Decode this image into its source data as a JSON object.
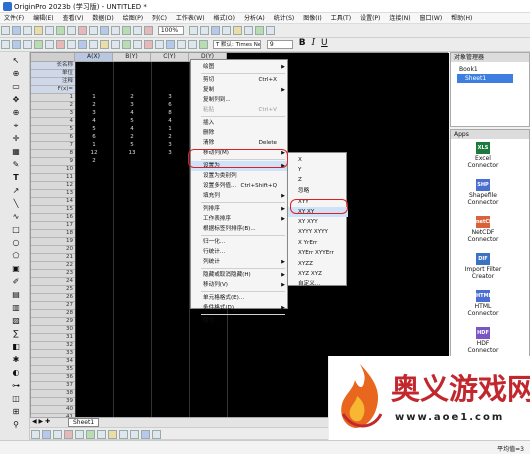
{
  "window": {
    "title": "OriginPro 2023b (学习版) - UNTITLED *"
  },
  "menubar": [
    "文件(F)",
    "编辑(E)",
    "查看(V)",
    "数据(D)",
    "绘图(P)",
    "列(C)",
    "工作表(W)",
    "格式(O)",
    "分析(A)",
    "统计(S)",
    "图像(I)",
    "工具(T)",
    "设置(P)",
    "连接(N)",
    "窗口(W)",
    "帮助(H)"
  ],
  "toolbar": {
    "zoom": "100%",
    "font_name": "T 默认: Times New",
    "font_size": "9",
    "bold": "B",
    "italic": "I",
    "underline": "U"
  },
  "worksheet": {
    "columns": [
      "A(X)",
      "B(Y)",
      "C(Y)",
      "D(Y)"
    ],
    "meta_rows": [
      "长名称",
      "单位",
      "注释",
      "F(x)="
    ],
    "row_numbers": [
      "1",
      "2",
      "3",
      "4",
      "5",
      "6",
      "7",
      "8",
      "9",
      "10",
      "11",
      "12",
      "13",
      "14",
      "15",
      "16",
      "17",
      "18",
      "19",
      "20",
      "21",
      "22",
      "23",
      "24",
      "25",
      "26",
      "27",
      "28",
      "29",
      "30",
      "31",
      "32",
      "33",
      "34",
      "35",
      "36",
      "37",
      "38",
      "39",
      "40",
      "41"
    ],
    "cells": [
      [
        "1",
        "2",
        "3"
      ],
      [
        "2",
        "3",
        "6"
      ],
      [
        "3",
        "4",
        "8"
      ],
      [
        "4",
        "5",
        "4"
      ],
      [
        "5",
        "4",
        "1"
      ],
      [
        "6",
        "2",
        "2"
      ],
      [
        "1",
        "5",
        "3"
      ],
      [
        "12",
        "13",
        "3"
      ],
      [
        "2",
        "",
        ""
      ]
    ]
  },
  "context_menu": {
    "items": [
      {
        "label": "绘图",
        "shortcut": "",
        "arrow": true
      },
      {
        "label": "剪切",
        "shortcut": "Ctrl+X"
      },
      {
        "label": "复制",
        "shortcut": "",
        "arrow": true
      },
      {
        "label": "复制列到...",
        "shortcut": ""
      },
      {
        "label": "粘贴",
        "shortcut": "Ctrl+V",
        "disabled": true
      },
      {
        "label": "插入",
        "shortcut": ""
      },
      {
        "label": "删除",
        "shortcut": ""
      },
      {
        "label": "清除",
        "shortcut": "Delete"
      },
      {
        "label": "移动列(M)",
        "shortcut": "",
        "arrow": true
      },
      {
        "label": "设置为",
        "shortcut": "",
        "arrow": true,
        "highlight": true
      },
      {
        "label": "设置为类别列",
        "shortcut": ""
      },
      {
        "label": "设置多列值...",
        "shortcut": "Ctrl+Shift+Q"
      },
      {
        "label": "填充列",
        "shortcut": "",
        "arrow": true
      },
      {
        "label": "列排序",
        "shortcut": "",
        "arrow": true
      },
      {
        "label": "工作表排序",
        "shortcut": "",
        "arrow": true
      },
      {
        "label": "根据标签列排序(B)...",
        "shortcut": ""
      },
      {
        "label": "归一化...",
        "shortcut": ""
      },
      {
        "label": "行统计...",
        "shortcut": ""
      },
      {
        "label": "列统计",
        "shortcut": "",
        "arrow": true
      },
      {
        "label": "隐藏或取消隐藏(H)",
        "shortcut": "",
        "arrow": true
      },
      {
        "label": "移动列(V)",
        "shortcut": "",
        "arrow": true
      },
      {
        "label": "单元格格式(E)...",
        "shortcut": ""
      },
      {
        "label": "条件格式(D)",
        "shortcut": "",
        "arrow": true
      },
      {
        "label": "属性...",
        "shortcut": ""
      }
    ]
  },
  "submenu": {
    "items": [
      "X",
      "Y",
      "Z",
      "忽略",
      "XYY",
      "XY XY",
      "XY XYY",
      "XYYY XYYY",
      "X YrErr",
      "XYErr XYYErr",
      "XYZZ",
      "XYZ XYZ",
      "自定义..."
    ],
    "highlighted": "XY XY"
  },
  "object_manager": {
    "title": "对象管理器",
    "book": "Book1",
    "sheet": "Sheet1"
  },
  "apps": {
    "title": "Apps",
    "items": [
      {
        "icon": "XLS",
        "label": "Excel Connector"
      },
      {
        "icon": "SHP",
        "label": "Shapefile Connector"
      },
      {
        "icon": "netCDF",
        "label": "NetCDF Connector"
      },
      {
        "icon": "DIF",
        "label": "Import Filter Creator"
      },
      {
        "icon": "HTML",
        "label": "HTML Connector"
      },
      {
        "icon": "HDF",
        "label": "HDF Connector"
      }
    ]
  },
  "sheet_tab": "Sheet1",
  "status": "平均值=3",
  "watermark": {
    "title": "奥义游戏网",
    "url": "www.aoe1.com"
  }
}
